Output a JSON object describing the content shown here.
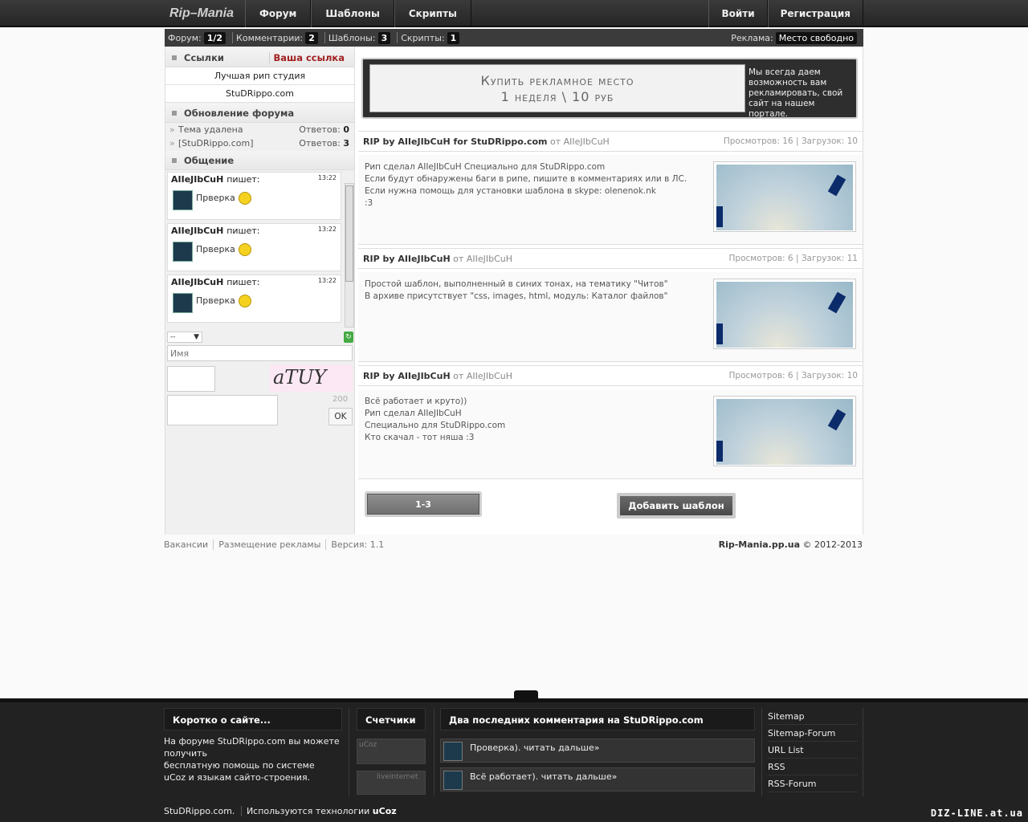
{
  "header": {
    "logo": "Rip–Mania",
    "nav": [
      "Форум",
      "Шаблоны",
      "Скрипты"
    ],
    "login": "Войти",
    "register": "Регистрация"
  },
  "stats": {
    "forum_label": "Форум:",
    "forum_val": "1/2",
    "comments_label": "Комментарии:",
    "comments_val": "2",
    "templates_label": "Шаблоны:",
    "templates_val": "3",
    "scripts_label": "Скрипты:",
    "scripts_val": "1",
    "ad_label": "Реклама:",
    "ad_val": "Место свободно"
  },
  "sidebar": {
    "links_title": "Ссылки",
    "your_link": "Ваша ссылка",
    "links": [
      "Лучшая рип студия",
      "StuDRippo.com"
    ],
    "forum_title": "Обновление форума",
    "forum_rows": [
      {
        "topic": "Тема удалена",
        "label": "Ответов:",
        "count": "0"
      },
      {
        "topic": "[StuDRippo.com]",
        "label": "Ответов:",
        "count": "3"
      }
    ],
    "chat_title": "Общение",
    "chat": [
      {
        "user": "AIIeJIbCuH",
        "says": "пишет:",
        "time": "13:22",
        "text": "Прверка"
      },
      {
        "user": "AIIeJIbCuH",
        "says": "пишет:",
        "time": "13:22",
        "text": "Прверка"
      },
      {
        "user": "AIIeJIbCuH",
        "says": "пишет:",
        "time": "13:22",
        "text": "Прверка"
      }
    ],
    "select_value": "--",
    "name_placeholder": "Имя",
    "captcha": "aTUY",
    "char_limit": "200",
    "ok": "OK"
  },
  "ad": {
    "line1": "Купить рекламное место",
    "line2": "1 неделя \\ 10 руб",
    "side": "Мы всегда даем возможность вам рекламировать, свой сайт на нашем портале."
  },
  "posts": [
    {
      "title": "RIP by AIIeJIbCuH for StuDRippo.com",
      "from": "от",
      "author": "AIIeJIbCuH",
      "views_label": "Просмотров:",
      "views": "16",
      "downloads_label": "Загрузок:",
      "downloads": "10",
      "lines": [
        "Рип сделал AIIeJIbCuH Специально для StuDRippo.com",
        "Если будут обнаружены баги в рипе, пишите в комментариях или в ЛС.",
        "Если нужна помощь для установки шаблона в skype: olenenok.nk",
        ":3"
      ]
    },
    {
      "title": "RIP by AIIeJIbCuH",
      "from": "от",
      "author": "AIIeJIbCuH",
      "views_label": "Просмотров:",
      "views": "6",
      "downloads_label": "Загрузок:",
      "downloads": "11",
      "lines": [
        "Простой шаблон, выполненный в синих тонах, на тематику \"Читов\"",
        "В архиве присутствует \"css, images, html, модуль: Каталог файлов\""
      ]
    },
    {
      "title": "RIP by AIIeJIbCuH",
      "from": "от",
      "author": "AIIeJIbCuH",
      "views_label": "Просмотров:",
      "views": "6",
      "downloads_label": "Загрузок:",
      "downloads": "10",
      "lines": [
        "Всё работает и круто))",
        "Рип сделал AIIeJIbCuH",
        "Специально для StuDRippo.com",
        "Кто скачал - тот няша :3"
      ]
    }
  ],
  "pager": "1-3",
  "add_template": "Добавить шаблон",
  "footer_links": [
    "Вакансии",
    "Размещение рекламы",
    "Версия: 1.1"
  ],
  "copyright_site": "Rip-Mania.pp.ua",
  "copyright_years": "© 2012-2013",
  "footer": {
    "about_title": "Коротко о сайте...",
    "about_text": [
      "На форуме StuDRippo.com вы можете получить",
      "бесплатную помощь по системе",
      "uCoz и языкам сайто-строения."
    ],
    "counters_title": "Счетчики",
    "counter1": "uCoz",
    "counter2": "liveinternet",
    "comments_title": "Два последних комментария на StuDRippo.com",
    "comments": [
      "Проверка). читать дальше»",
      "Всё работает). читать дальше»"
    ],
    "links": [
      "Sitemap",
      "Sitemap-Forum",
      "URL List",
      "RSS",
      "RSS-Forum"
    ],
    "bottom_site": "StuDRippo.com.",
    "bottom_tech": "Используются технологии",
    "bottom_ucoz": "uCoz",
    "watermark": "DIZ-LINE.at.ua"
  }
}
